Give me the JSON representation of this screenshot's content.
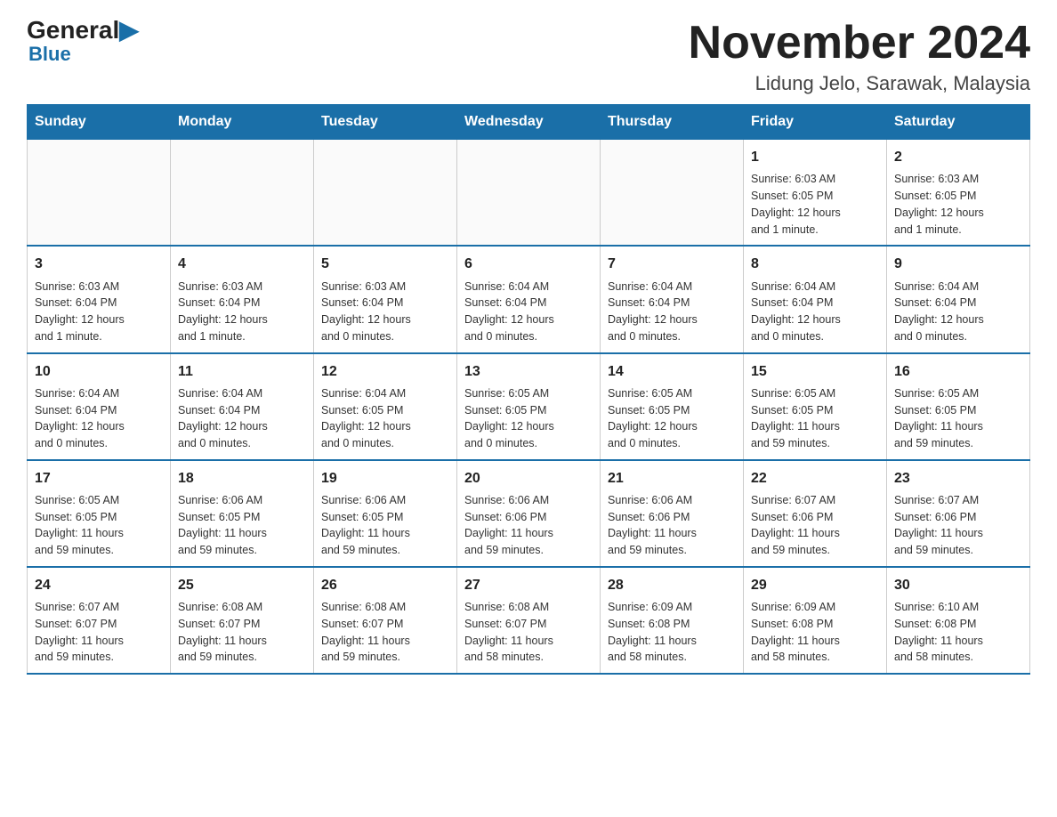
{
  "logo": {
    "general": "General",
    "blue": "Blue"
  },
  "title": "November 2024",
  "subtitle": "Lidung Jelo, Sarawak, Malaysia",
  "weekdays": [
    "Sunday",
    "Monday",
    "Tuesday",
    "Wednesday",
    "Thursday",
    "Friday",
    "Saturday"
  ],
  "weeks": [
    [
      {
        "day": "",
        "info": ""
      },
      {
        "day": "",
        "info": ""
      },
      {
        "day": "",
        "info": ""
      },
      {
        "day": "",
        "info": ""
      },
      {
        "day": "",
        "info": ""
      },
      {
        "day": "1",
        "info": "Sunrise: 6:03 AM\nSunset: 6:05 PM\nDaylight: 12 hours\nand 1 minute."
      },
      {
        "day": "2",
        "info": "Sunrise: 6:03 AM\nSunset: 6:05 PM\nDaylight: 12 hours\nand 1 minute."
      }
    ],
    [
      {
        "day": "3",
        "info": "Sunrise: 6:03 AM\nSunset: 6:04 PM\nDaylight: 12 hours\nand 1 minute."
      },
      {
        "day": "4",
        "info": "Sunrise: 6:03 AM\nSunset: 6:04 PM\nDaylight: 12 hours\nand 1 minute."
      },
      {
        "day": "5",
        "info": "Sunrise: 6:03 AM\nSunset: 6:04 PM\nDaylight: 12 hours\nand 0 minutes."
      },
      {
        "day": "6",
        "info": "Sunrise: 6:04 AM\nSunset: 6:04 PM\nDaylight: 12 hours\nand 0 minutes."
      },
      {
        "day": "7",
        "info": "Sunrise: 6:04 AM\nSunset: 6:04 PM\nDaylight: 12 hours\nand 0 minutes."
      },
      {
        "day": "8",
        "info": "Sunrise: 6:04 AM\nSunset: 6:04 PM\nDaylight: 12 hours\nand 0 minutes."
      },
      {
        "day": "9",
        "info": "Sunrise: 6:04 AM\nSunset: 6:04 PM\nDaylight: 12 hours\nand 0 minutes."
      }
    ],
    [
      {
        "day": "10",
        "info": "Sunrise: 6:04 AM\nSunset: 6:04 PM\nDaylight: 12 hours\nand 0 minutes."
      },
      {
        "day": "11",
        "info": "Sunrise: 6:04 AM\nSunset: 6:04 PM\nDaylight: 12 hours\nand 0 minutes."
      },
      {
        "day": "12",
        "info": "Sunrise: 6:04 AM\nSunset: 6:05 PM\nDaylight: 12 hours\nand 0 minutes."
      },
      {
        "day": "13",
        "info": "Sunrise: 6:05 AM\nSunset: 6:05 PM\nDaylight: 12 hours\nand 0 minutes."
      },
      {
        "day": "14",
        "info": "Sunrise: 6:05 AM\nSunset: 6:05 PM\nDaylight: 12 hours\nand 0 minutes."
      },
      {
        "day": "15",
        "info": "Sunrise: 6:05 AM\nSunset: 6:05 PM\nDaylight: 11 hours\nand 59 minutes."
      },
      {
        "day": "16",
        "info": "Sunrise: 6:05 AM\nSunset: 6:05 PM\nDaylight: 11 hours\nand 59 minutes."
      }
    ],
    [
      {
        "day": "17",
        "info": "Sunrise: 6:05 AM\nSunset: 6:05 PM\nDaylight: 11 hours\nand 59 minutes."
      },
      {
        "day": "18",
        "info": "Sunrise: 6:06 AM\nSunset: 6:05 PM\nDaylight: 11 hours\nand 59 minutes."
      },
      {
        "day": "19",
        "info": "Sunrise: 6:06 AM\nSunset: 6:05 PM\nDaylight: 11 hours\nand 59 minutes."
      },
      {
        "day": "20",
        "info": "Sunrise: 6:06 AM\nSunset: 6:06 PM\nDaylight: 11 hours\nand 59 minutes."
      },
      {
        "day": "21",
        "info": "Sunrise: 6:06 AM\nSunset: 6:06 PM\nDaylight: 11 hours\nand 59 minutes."
      },
      {
        "day": "22",
        "info": "Sunrise: 6:07 AM\nSunset: 6:06 PM\nDaylight: 11 hours\nand 59 minutes."
      },
      {
        "day": "23",
        "info": "Sunrise: 6:07 AM\nSunset: 6:06 PM\nDaylight: 11 hours\nand 59 minutes."
      }
    ],
    [
      {
        "day": "24",
        "info": "Sunrise: 6:07 AM\nSunset: 6:07 PM\nDaylight: 11 hours\nand 59 minutes."
      },
      {
        "day": "25",
        "info": "Sunrise: 6:08 AM\nSunset: 6:07 PM\nDaylight: 11 hours\nand 59 minutes."
      },
      {
        "day": "26",
        "info": "Sunrise: 6:08 AM\nSunset: 6:07 PM\nDaylight: 11 hours\nand 59 minutes."
      },
      {
        "day": "27",
        "info": "Sunrise: 6:08 AM\nSunset: 6:07 PM\nDaylight: 11 hours\nand 58 minutes."
      },
      {
        "day": "28",
        "info": "Sunrise: 6:09 AM\nSunset: 6:08 PM\nDaylight: 11 hours\nand 58 minutes."
      },
      {
        "day": "29",
        "info": "Sunrise: 6:09 AM\nSunset: 6:08 PM\nDaylight: 11 hours\nand 58 minutes."
      },
      {
        "day": "30",
        "info": "Sunrise: 6:10 AM\nSunset: 6:08 PM\nDaylight: 11 hours\nand 58 minutes."
      }
    ]
  ]
}
